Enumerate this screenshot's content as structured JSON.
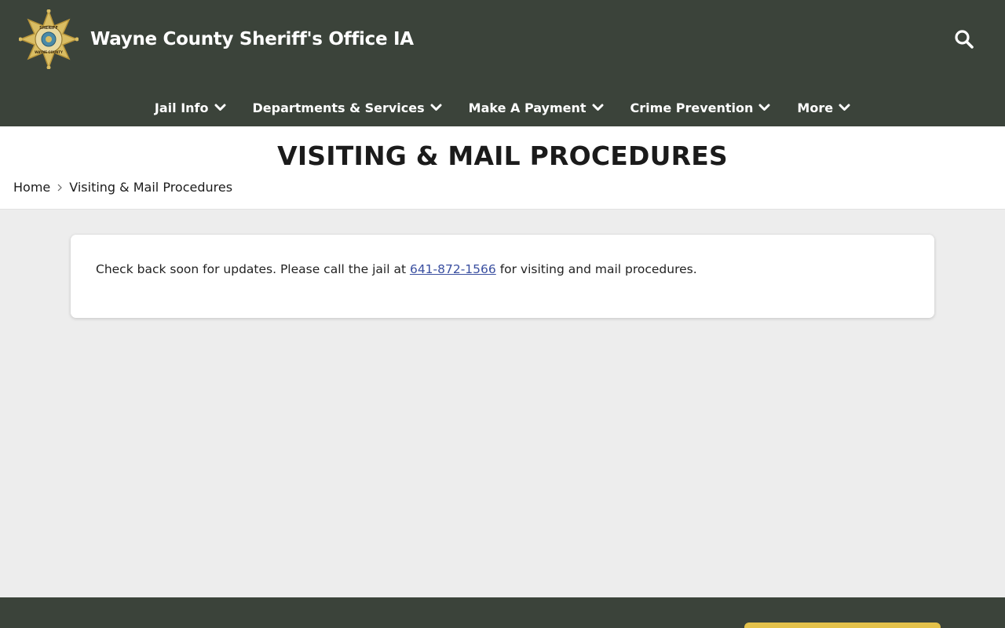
{
  "header": {
    "site_title": "Wayne County Sheriff's Office IA",
    "logo_icon": "sheriff-badge-icon",
    "badge_text": {
      "top": "SHERIFF",
      "bottom": "WAYNE COUNTY"
    },
    "search_icon": "search-icon"
  },
  "nav": {
    "items": [
      {
        "label": "Jail Info"
      },
      {
        "label": "Departments & Services"
      },
      {
        "label": "Make A Payment"
      },
      {
        "label": "Crime Prevention"
      },
      {
        "label": "More"
      }
    ]
  },
  "page": {
    "title": "VISITING & MAIL PROCEDURES",
    "breadcrumb": {
      "home": "Home",
      "current": "Visiting & Mail Procedures"
    }
  },
  "content": {
    "text_before": "Check back soon for updates. Please call the jail at ",
    "phone": "641-872-1566",
    "text_after": " for visiting and mail procedures."
  },
  "colors": {
    "header_bg": "#3b433a",
    "page_bg": "#ededed",
    "link": "#3a4fa0",
    "accent_gold": "#e3c14a"
  }
}
